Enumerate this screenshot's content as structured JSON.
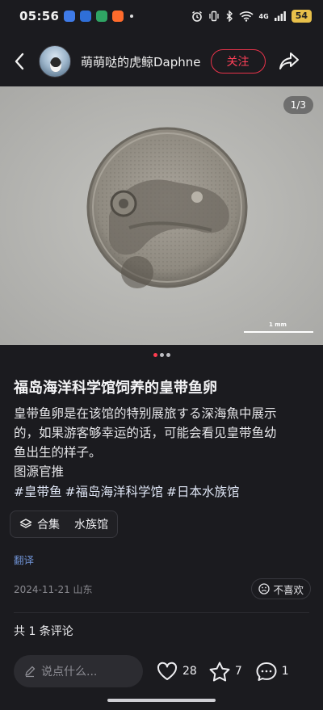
{
  "status_bar": {
    "time": "05:56",
    "signal_label": "4G",
    "battery": "54",
    "icons": [
      "alarm-icon",
      "vibrate-icon",
      "bluetooth-icon",
      "wifi-icon",
      "signal-icon"
    ],
    "app_icon_colors": [
      "#3f7be8",
      "#2f6fd8",
      "#2fa464",
      "#ff6b2c"
    ]
  },
  "header": {
    "username": "萌萌哒的虎鲸Daphne",
    "follow_label": "关注",
    "accent_color": "#ff4058"
  },
  "media": {
    "page_indicator": "1/3",
    "scale_label": "1 mm",
    "current_page": 1,
    "total_pages": 3
  },
  "post": {
    "title": "福岛海洋科学馆饲养的皇带鱼卵",
    "body_lines": [
      "皇带鱼卵是在该馆的特别展旅する深海魚中展示",
      "的，如果游客够幸运的话，可能会看见皇带鱼幼",
      "鱼出生的样子。",
      "图源官推"
    ],
    "tags": [
      "#皇带鱼",
      "#福岛海洋科学馆",
      "#日本水族馆"
    ],
    "collection_label": "合集",
    "collection_name": "水族馆",
    "translate_label": "翻译",
    "date_location": "2024-11-21 山东",
    "dislike_label": "不喜欢"
  },
  "comments": {
    "count_label": "共 1 条评论"
  },
  "bottom_bar": {
    "input_placeholder": "说点什么...",
    "likes": "28",
    "favorites": "7",
    "comments": "1"
  }
}
